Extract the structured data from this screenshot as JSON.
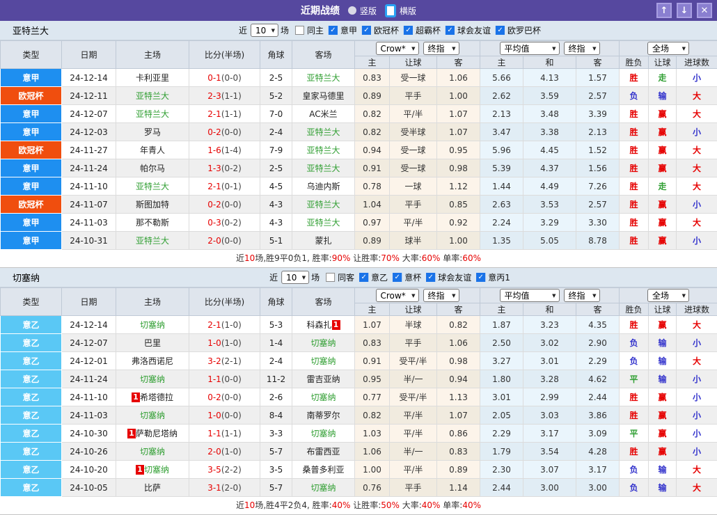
{
  "titlebar": {
    "title": "近期战绩",
    "radios": [
      {
        "label": "竖版",
        "selected": false
      },
      {
        "label": "横版",
        "selected": true
      }
    ],
    "buttons": [
      {
        "name": "scroll-up-icon",
        "glyph": "↑"
      },
      {
        "name": "scroll-down-icon",
        "glyph": "↓"
      },
      {
        "name": "close-icon",
        "glyph": "✕"
      }
    ]
  },
  "league_colors": {
    "意甲": "#1e8ff0",
    "欧冠杯": "#f04e0e",
    "意乙": "#5ac8f5"
  },
  "result_colors": {
    "red": "#e60000",
    "blue": "#3333cc",
    "green": "#2e9e31"
  },
  "sections": [
    {
      "team": "亚特兰大",
      "filter": {
        "near_label": "近",
        "games_value": "10",
        "games_suffix": "场",
        "same": {
          "label": "同主",
          "checked": false
        },
        "leagues": [
          {
            "label": "意甲",
            "checked": true
          },
          {
            "label": "欧冠杯",
            "checked": true
          },
          {
            "label": "超霸杯",
            "checked": true
          },
          {
            "label": "球会友谊",
            "checked": true
          },
          {
            "label": "欧罗巴杯",
            "checked": true
          }
        ]
      },
      "header": {
        "cols": [
          "类型",
          "日期",
          "主场",
          "比分(半场)",
          "角球",
          "客场"
        ],
        "group1": {
          "select1": "Crow*",
          "select2": "终指",
          "cols": [
            "主",
            "让球",
            "客"
          ]
        },
        "group2": {
          "select1": "平均值",
          "select2": "终指",
          "cols": [
            "主",
            "和",
            "客"
          ]
        },
        "group3": {
          "select": "全场",
          "cols": [
            "胜负",
            "让球",
            "进球数"
          ]
        }
      },
      "rows": [
        {
          "lg": "意甲",
          "date": "24-12-14",
          "home": "卡利亚里",
          "hg": false,
          "hb": "",
          "score": "0-1",
          "half": "(0-0)",
          "cn": "2-5",
          "away": "亚特兰大",
          "ag": true,
          "ab": "",
          "o": [
            "0.83",
            "受一球",
            "1.06"
          ],
          "a": [
            "5.66",
            "4.13",
            "1.57"
          ],
          "r": [
            [
              "胜",
              "red"
            ],
            [
              "走",
              "green"
            ],
            [
              "小",
              "blue"
            ]
          ]
        },
        {
          "lg": "欧冠杯",
          "date": "24-12-11",
          "home": "亚特兰大",
          "hg": true,
          "hb": "",
          "score": "2-3",
          "half": "(1-1)",
          "cn": "5-2",
          "away": "皇家马德里",
          "ag": false,
          "ab": "",
          "o": [
            "0.89",
            "平手",
            "1.00"
          ],
          "a": [
            "2.62",
            "3.59",
            "2.57"
          ],
          "r": [
            [
              "负",
              "blue"
            ],
            [
              "输",
              "blue"
            ],
            [
              "大",
              "red"
            ]
          ]
        },
        {
          "lg": "意甲",
          "date": "24-12-07",
          "home": "亚特兰大",
          "hg": true,
          "hb": "",
          "score": "2-1",
          "half": "(1-1)",
          "cn": "7-0",
          "away": "AC米兰",
          "ag": false,
          "ab": "",
          "o": [
            "0.82",
            "平/半",
            "1.07"
          ],
          "a": [
            "2.13",
            "3.48",
            "3.39"
          ],
          "r": [
            [
              "胜",
              "red"
            ],
            [
              "赢",
              "red"
            ],
            [
              "大",
              "red"
            ]
          ]
        },
        {
          "lg": "意甲",
          "date": "24-12-03",
          "home": "罗马",
          "hg": false,
          "hb": "",
          "score": "0-2",
          "half": "(0-0)",
          "cn": "2-4",
          "away": "亚特兰大",
          "ag": true,
          "ab": "",
          "o": [
            "0.82",
            "受半球",
            "1.07"
          ],
          "a": [
            "3.47",
            "3.38",
            "2.13"
          ],
          "r": [
            [
              "胜",
              "red"
            ],
            [
              "赢",
              "red"
            ],
            [
              "小",
              "blue"
            ]
          ]
        },
        {
          "lg": "欧冠杯",
          "date": "24-11-27",
          "home": "年青人",
          "hg": false,
          "hb": "",
          "score": "1-6",
          "half": "(1-4)",
          "cn": "7-9",
          "away": "亚特兰大",
          "ag": true,
          "ab": "",
          "o": [
            "0.94",
            "受一球",
            "0.95"
          ],
          "a": [
            "5.96",
            "4.45",
            "1.52"
          ],
          "r": [
            [
              "胜",
              "red"
            ],
            [
              "赢",
              "red"
            ],
            [
              "大",
              "red"
            ]
          ]
        },
        {
          "lg": "意甲",
          "date": "24-11-24",
          "home": "帕尔马",
          "hg": false,
          "hb": "",
          "score": "1-3",
          "half": "(0-2)",
          "cn": "2-5",
          "away": "亚特兰大",
          "ag": true,
          "ab": "",
          "o": [
            "0.91",
            "受一球",
            "0.98"
          ],
          "a": [
            "5.39",
            "4.37",
            "1.56"
          ],
          "r": [
            [
              "胜",
              "red"
            ],
            [
              "赢",
              "red"
            ],
            [
              "大",
              "red"
            ]
          ]
        },
        {
          "lg": "意甲",
          "date": "24-11-10",
          "home": "亚特兰大",
          "hg": true,
          "hb": "",
          "score": "2-1",
          "half": "(0-1)",
          "cn": "4-5",
          "away": "乌迪内斯",
          "ag": false,
          "ab": "",
          "o": [
            "0.78",
            "一球",
            "1.12"
          ],
          "a": [
            "1.44",
            "4.49",
            "7.26"
          ],
          "r": [
            [
              "胜",
              "red"
            ],
            [
              "走",
              "green"
            ],
            [
              "大",
              "red"
            ]
          ]
        },
        {
          "lg": "欧冠杯",
          "date": "24-11-07",
          "home": "斯图加特",
          "hg": false,
          "hb": "",
          "score": "0-2",
          "half": "(0-0)",
          "cn": "4-3",
          "away": "亚特兰大",
          "ag": true,
          "ab": "",
          "o": [
            "1.04",
            "平手",
            "0.85"
          ],
          "a": [
            "2.63",
            "3.53",
            "2.57"
          ],
          "r": [
            [
              "胜",
              "red"
            ],
            [
              "赢",
              "red"
            ],
            [
              "小",
              "blue"
            ]
          ]
        },
        {
          "lg": "意甲",
          "date": "24-11-03",
          "home": "那不勒斯",
          "hg": false,
          "hb": "",
          "score": "0-3",
          "half": "(0-2)",
          "cn": "4-3",
          "away": "亚特兰大",
          "ag": true,
          "ab": "",
          "o": [
            "0.97",
            "平/半",
            "0.92"
          ],
          "a": [
            "2.24",
            "3.29",
            "3.30"
          ],
          "r": [
            [
              "胜",
              "red"
            ],
            [
              "赢",
              "red"
            ],
            [
              "大",
              "red"
            ]
          ]
        },
        {
          "lg": "意甲",
          "date": "24-10-31",
          "home": "亚特兰大",
          "hg": true,
          "hb": "",
          "score": "2-0",
          "half": "(0-0)",
          "cn": "5-1",
          "away": "蒙扎",
          "ag": false,
          "ab": "",
          "o": [
            "0.89",
            "球半",
            "1.00"
          ],
          "a": [
            "1.35",
            "5.05",
            "8.78"
          ],
          "r": [
            [
              "胜",
              "red"
            ],
            [
              "赢",
              "red"
            ],
            [
              "小",
              "blue"
            ]
          ]
        }
      ],
      "summary": [
        {
          "text": "近",
          "red": false
        },
        {
          "text": "10",
          "red": true
        },
        {
          "text": "场,胜9平0负1, 胜率:",
          "red": false
        },
        {
          "text": "90%",
          "red": true
        },
        {
          "text": " 让胜率:",
          "red": false
        },
        {
          "text": "70%",
          "red": true
        },
        {
          "text": " 大率:",
          "red": false
        },
        {
          "text": "60%",
          "red": true
        },
        {
          "text": " 单率:",
          "red": false
        },
        {
          "text": "60%",
          "red": true
        }
      ]
    },
    {
      "team": "切塞纳",
      "filter": {
        "near_label": "近",
        "games_value": "10",
        "games_suffix": "场",
        "same": {
          "label": "同客",
          "checked": false
        },
        "leagues": [
          {
            "label": "意乙",
            "checked": true
          },
          {
            "label": "意杯",
            "checked": true
          },
          {
            "label": "球会友谊",
            "checked": true
          },
          {
            "label": "意丙1",
            "checked": true
          }
        ]
      },
      "header": {
        "cols": [
          "类型",
          "日期",
          "主场",
          "比分(半场)",
          "角球",
          "客场"
        ],
        "group1": {
          "select1": "Crow*",
          "select2": "终指",
          "cols": [
            "主",
            "让球",
            "客"
          ]
        },
        "group2": {
          "select1": "平均值",
          "select2": "终指",
          "cols": [
            "主",
            "和",
            "客"
          ]
        },
        "group3": {
          "select": "全场",
          "cols": [
            "胜负",
            "让球",
            "进球数"
          ]
        }
      },
      "rows": [
        {
          "lg": "意乙",
          "date": "24-12-14",
          "home": "切塞纳",
          "hg": true,
          "hb": "",
          "score": "2-1",
          "half": "(1-0)",
          "cn": "5-3",
          "away": "科森扎",
          "ag": false,
          "ab": "after",
          "badge": "1",
          "o": [
            "1.07",
            "半球",
            "0.82"
          ],
          "a": [
            "1.87",
            "3.23",
            "4.35"
          ],
          "r": [
            [
              "胜",
              "red"
            ],
            [
              "赢",
              "red"
            ],
            [
              "大",
              "red"
            ]
          ]
        },
        {
          "lg": "意乙",
          "date": "24-12-07",
          "home": "巴里",
          "hg": false,
          "hb": "",
          "score": "1-0",
          "half": "(1-0)",
          "cn": "1-4",
          "away": "切塞纳",
          "ag": true,
          "ab": "",
          "o": [
            "0.83",
            "平手",
            "1.06"
          ],
          "a": [
            "2.50",
            "3.02",
            "2.90"
          ],
          "r": [
            [
              "负",
              "blue"
            ],
            [
              "输",
              "blue"
            ],
            [
              "小",
              "blue"
            ]
          ]
        },
        {
          "lg": "意乙",
          "date": "24-12-01",
          "home": "弗洛西诺尼",
          "hg": false,
          "hb": "",
          "score": "3-2",
          "half": "(2-1)",
          "cn": "2-4",
          "away": "切塞纳",
          "ag": true,
          "ab": "",
          "o": [
            "0.91",
            "受平/半",
            "0.98"
          ],
          "a": [
            "3.27",
            "3.01",
            "2.29"
          ],
          "r": [
            [
              "负",
              "blue"
            ],
            [
              "输",
              "blue"
            ],
            [
              "大",
              "red"
            ]
          ]
        },
        {
          "lg": "意乙",
          "date": "24-11-24",
          "home": "切塞纳",
          "hg": true,
          "hb": "",
          "score": "1-1",
          "half": "(0-0)",
          "cn": "11-2",
          "away": "雷吉亚纳",
          "ag": false,
          "ab": "",
          "o": [
            "0.95",
            "半/一",
            "0.94"
          ],
          "a": [
            "1.80",
            "3.28",
            "4.62"
          ],
          "r": [
            [
              "平",
              "green"
            ],
            [
              "输",
              "blue"
            ],
            [
              "小",
              "blue"
            ]
          ]
        },
        {
          "lg": "意乙",
          "date": "24-11-10",
          "home": "希塔德拉",
          "hg": false,
          "hb": "before",
          "badge": "1",
          "score": "0-2",
          "half": "(0-0)",
          "cn": "2-6",
          "away": "切塞纳",
          "ag": true,
          "ab": "",
          "o": [
            "0.77",
            "受平/半",
            "1.13"
          ],
          "a": [
            "3.01",
            "2.99",
            "2.44"
          ],
          "r": [
            [
              "胜",
              "red"
            ],
            [
              "赢",
              "red"
            ],
            [
              "小",
              "blue"
            ]
          ]
        },
        {
          "lg": "意乙",
          "date": "24-11-03",
          "home": "切塞纳",
          "hg": true,
          "hb": "",
          "score": "1-0",
          "half": "(0-0)",
          "cn": "8-4",
          "away": "南蒂罗尔",
          "ag": false,
          "ab": "",
          "o": [
            "0.82",
            "平/半",
            "1.07"
          ],
          "a": [
            "2.05",
            "3.03",
            "3.86"
          ],
          "r": [
            [
              "胜",
              "red"
            ],
            [
              "赢",
              "red"
            ],
            [
              "小",
              "blue"
            ]
          ]
        },
        {
          "lg": "意乙",
          "date": "24-10-30",
          "home": "萨勒尼塔纳",
          "hg": false,
          "hb": "before",
          "badge": "1",
          "score": "1-1",
          "half": "(1-1)",
          "cn": "3-3",
          "away": "切塞纳",
          "ag": true,
          "ab": "",
          "o": [
            "1.03",
            "平/半",
            "0.86"
          ],
          "a": [
            "2.29",
            "3.17",
            "3.09"
          ],
          "r": [
            [
              "平",
              "green"
            ],
            [
              "赢",
              "red"
            ],
            [
              "小",
              "blue"
            ]
          ]
        },
        {
          "lg": "意乙",
          "date": "24-10-26",
          "home": "切塞纳",
          "hg": true,
          "hb": "",
          "score": "2-0",
          "half": "(1-0)",
          "cn": "5-7",
          "away": "布雷西亚",
          "ag": false,
          "ab": "",
          "o": [
            "1.06",
            "半/一",
            "0.83"
          ],
          "a": [
            "1.79",
            "3.54",
            "4.28"
          ],
          "r": [
            [
              "胜",
              "red"
            ],
            [
              "赢",
              "red"
            ],
            [
              "小",
              "blue"
            ]
          ]
        },
        {
          "lg": "意乙",
          "date": "24-10-20",
          "home": "切塞纳",
          "hg": true,
          "hb": "before",
          "badge": "1",
          "score": "3-5",
          "half": "(2-2)",
          "cn": "3-5",
          "away": "桑普多利亚",
          "ag": false,
          "ab": "",
          "o": [
            "1.00",
            "平/半",
            "0.89"
          ],
          "a": [
            "2.30",
            "3.07",
            "3.17"
          ],
          "r": [
            [
              "负",
              "blue"
            ],
            [
              "输",
              "blue"
            ],
            [
              "大",
              "red"
            ]
          ]
        },
        {
          "lg": "意乙",
          "date": "24-10-05",
          "home": "比萨",
          "hg": false,
          "hb": "",
          "score": "3-1",
          "half": "(2-0)",
          "cn": "5-7",
          "away": "切塞纳",
          "ag": true,
          "ab": "",
          "o": [
            "0.76",
            "平手",
            "1.14"
          ],
          "a": [
            "2.44",
            "3.00",
            "3.00"
          ],
          "r": [
            [
              "负",
              "blue"
            ],
            [
              "输",
              "blue"
            ],
            [
              "大",
              "red"
            ]
          ]
        }
      ],
      "summary": [
        {
          "text": "近",
          "red": false
        },
        {
          "text": "10",
          "red": true
        },
        {
          "text": "场,胜4平2负4, 胜率:",
          "red": false
        },
        {
          "text": "40%",
          "red": true
        },
        {
          "text": " 让胜率:",
          "red": false
        },
        {
          "text": "50%",
          "red": true
        },
        {
          "text": " 大率:",
          "red": false
        },
        {
          "text": "40%",
          "red": true
        },
        {
          "text": " 单率:",
          "red": false
        },
        {
          "text": "40%",
          "red": true
        }
      ]
    }
  ]
}
